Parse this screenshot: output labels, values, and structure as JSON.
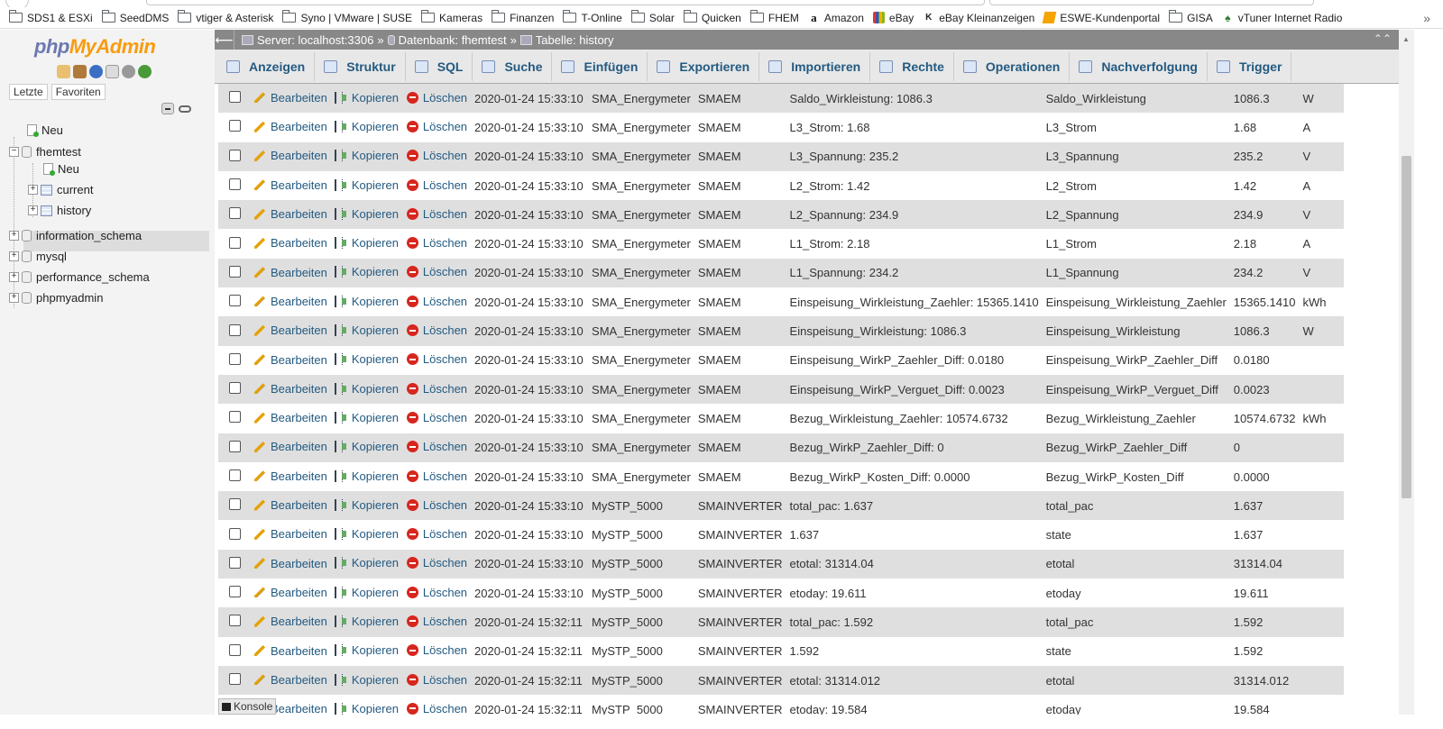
{
  "bookmarks": [
    {
      "label": "SDS1 & ESXi",
      "icon": "folder-icon"
    },
    {
      "label": "SeedDMS",
      "icon": "folder-icon"
    },
    {
      "label": "vtiger & Asterisk",
      "icon": "folder-icon"
    },
    {
      "label": "Syno | VMware | SUSE",
      "icon": "folder-icon"
    },
    {
      "label": "Kameras",
      "icon": "folder-icon"
    },
    {
      "label": "Finanzen",
      "icon": "folder-icon"
    },
    {
      "label": "T-Online",
      "icon": "folder-icon"
    },
    {
      "label": "Solar",
      "icon": "folder-icon"
    },
    {
      "label": "Quicken",
      "icon": "folder-icon"
    },
    {
      "label": "FHEM",
      "icon": "folder-icon"
    },
    {
      "label": "Amazon",
      "icon": "amazon-icon"
    },
    {
      "label": "eBay",
      "icon": "ebay-icon"
    },
    {
      "label": "eBay Kleinanzeigen",
      "icon": "kleinanzeigen-icon"
    },
    {
      "label": "ESWE-Kundenportal",
      "icon": "eswe-icon"
    },
    {
      "label": "GISA",
      "icon": "folder-icon"
    },
    {
      "label": "vTuner Internet Radio",
      "icon": "vtuner-icon"
    }
  ],
  "sidebar": {
    "logo_php": "php",
    "logo_myadmin": "MyAdmin",
    "tab_recent": "Letzte",
    "tab_favorites": "Favoriten",
    "tree": {
      "new_top": "Neu",
      "db_fhemtest": "fhemtest",
      "new_sub": "Neu",
      "tbl_current": "current",
      "tbl_history": "history",
      "db_information_schema": "information_schema",
      "db_mysql": "mysql",
      "db_performance_schema": "performance_schema",
      "db_phpmyadmin": "phpmyadmin"
    }
  },
  "breadcrumb": {
    "server": "Server: localhost:3306",
    "database": "Datenbank: fhemtest",
    "table": "Tabelle: history",
    "sep": "»"
  },
  "tabs": [
    "Anzeigen",
    "Struktur",
    "SQL",
    "Suche",
    "Einfügen",
    "Exportieren",
    "Importieren",
    "Rechte",
    "Operationen",
    "Nachverfolgung",
    "Trigger"
  ],
  "row_actions": {
    "edit": "Bearbeiten",
    "copy": "Kopieren",
    "delete": "Löschen"
  },
  "rows": [
    {
      "ts": "2020-01-24 15:33:10",
      "device": "SMA_Energymeter",
      "type": "SMAEM",
      "event": "Saldo_Wirkleistung: 1086.3",
      "reading": "Saldo_Wirkleistung",
      "value": "1086.3",
      "unit": "W"
    },
    {
      "ts": "2020-01-24 15:33:10",
      "device": "SMA_Energymeter",
      "type": "SMAEM",
      "event": "L3_Strom: 1.68",
      "reading": "L3_Strom",
      "value": "1.68",
      "unit": "A"
    },
    {
      "ts": "2020-01-24 15:33:10",
      "device": "SMA_Energymeter",
      "type": "SMAEM",
      "event": "L3_Spannung: 235.2",
      "reading": "L3_Spannung",
      "value": "235.2",
      "unit": "V"
    },
    {
      "ts": "2020-01-24 15:33:10",
      "device": "SMA_Energymeter",
      "type": "SMAEM",
      "event": "L2_Strom: 1.42",
      "reading": "L2_Strom",
      "value": "1.42",
      "unit": "A"
    },
    {
      "ts": "2020-01-24 15:33:10",
      "device": "SMA_Energymeter",
      "type": "SMAEM",
      "event": "L2_Spannung: 234.9",
      "reading": "L2_Spannung",
      "value": "234.9",
      "unit": "V"
    },
    {
      "ts": "2020-01-24 15:33:10",
      "device": "SMA_Energymeter",
      "type": "SMAEM",
      "event": "L1_Strom: 2.18",
      "reading": "L1_Strom",
      "value": "2.18",
      "unit": "A"
    },
    {
      "ts": "2020-01-24 15:33:10",
      "device": "SMA_Energymeter",
      "type": "SMAEM",
      "event": "L1_Spannung: 234.2",
      "reading": "L1_Spannung",
      "value": "234.2",
      "unit": "V"
    },
    {
      "ts": "2020-01-24 15:33:10",
      "device": "SMA_Energymeter",
      "type": "SMAEM",
      "event": "Einspeisung_Wirkleistung_Zaehler: 15365.1410",
      "reading": "Einspeisung_Wirkleistung_Zaehler",
      "value": "15365.1410",
      "unit": "kWh"
    },
    {
      "ts": "2020-01-24 15:33:10",
      "device": "SMA_Energymeter",
      "type": "SMAEM",
      "event": "Einspeisung_Wirkleistung: 1086.3",
      "reading": "Einspeisung_Wirkleistung",
      "value": "1086.3",
      "unit": "W"
    },
    {
      "ts": "2020-01-24 15:33:10",
      "device": "SMA_Energymeter",
      "type": "SMAEM",
      "event": "Einspeisung_WirkP_Zaehler_Diff: 0.0180",
      "reading": "Einspeisung_WirkP_Zaehler_Diff",
      "value": "0.0180",
      "unit": ""
    },
    {
      "ts": "2020-01-24 15:33:10",
      "device": "SMA_Energymeter",
      "type": "SMAEM",
      "event": "Einspeisung_WirkP_Verguet_Diff: 0.0023",
      "reading": "Einspeisung_WirkP_Verguet_Diff",
      "value": "0.0023",
      "unit": ""
    },
    {
      "ts": "2020-01-24 15:33:10",
      "device": "SMA_Energymeter",
      "type": "SMAEM",
      "event": "Bezug_Wirkleistung_Zaehler: 10574.6732",
      "reading": "Bezug_Wirkleistung_Zaehler",
      "value": "10574.6732",
      "unit": "kWh"
    },
    {
      "ts": "2020-01-24 15:33:10",
      "device": "SMA_Energymeter",
      "type": "SMAEM",
      "event": "Bezug_WirkP_Zaehler_Diff: 0",
      "reading": "Bezug_WirkP_Zaehler_Diff",
      "value": "0",
      "unit": ""
    },
    {
      "ts": "2020-01-24 15:33:10",
      "device": "SMA_Energymeter",
      "type": "SMAEM",
      "event": "Bezug_WirkP_Kosten_Diff: 0.0000",
      "reading": "Bezug_WirkP_Kosten_Diff",
      "value": "0.0000",
      "unit": ""
    },
    {
      "ts": "2020-01-24 15:33:10",
      "device": "MySTP_5000",
      "type": "SMAINVERTER",
      "event": "total_pac: 1.637",
      "reading": "total_pac",
      "value": "1.637",
      "unit": ""
    },
    {
      "ts": "2020-01-24 15:33:10",
      "device": "MySTP_5000",
      "type": "SMAINVERTER",
      "event": "1.637",
      "reading": "state",
      "value": "1.637",
      "unit": ""
    },
    {
      "ts": "2020-01-24 15:33:10",
      "device": "MySTP_5000",
      "type": "SMAINVERTER",
      "event": "etotal: 31314.04",
      "reading": "etotal",
      "value": "31314.04",
      "unit": ""
    },
    {
      "ts": "2020-01-24 15:33:10",
      "device": "MySTP_5000",
      "type": "SMAINVERTER",
      "event": "etoday: 19.611",
      "reading": "etoday",
      "value": "19.611",
      "unit": ""
    },
    {
      "ts": "2020-01-24 15:32:11",
      "device": "MySTP_5000",
      "type": "SMAINVERTER",
      "event": "total_pac: 1.592",
      "reading": "total_pac",
      "value": "1.592",
      "unit": ""
    },
    {
      "ts": "2020-01-24 15:32:11",
      "device": "MySTP_5000",
      "type": "SMAINVERTER",
      "event": "1.592",
      "reading": "state",
      "value": "1.592",
      "unit": ""
    },
    {
      "ts": "2020-01-24 15:32:11",
      "device": "MySTP_5000",
      "type": "SMAINVERTER",
      "event": "etotal: 31314.012",
      "reading": "etotal",
      "value": "31314.012",
      "unit": ""
    },
    {
      "ts": "2020-01-24 15:32:11",
      "device": "MySTP_5000",
      "type": "SMAINVERTER",
      "event": "etoday: 19.584",
      "reading": "etoday",
      "value": "19.584",
      "unit": ""
    }
  ],
  "console_label": "Konsole",
  "colors": {
    "link": "#235a81",
    "accent_orange": "#f89c0e",
    "accent_purple": "#6c78af",
    "row_alt": "#dfdfdf",
    "header_grey": "#888888",
    "delete_red": "#d7261e"
  }
}
